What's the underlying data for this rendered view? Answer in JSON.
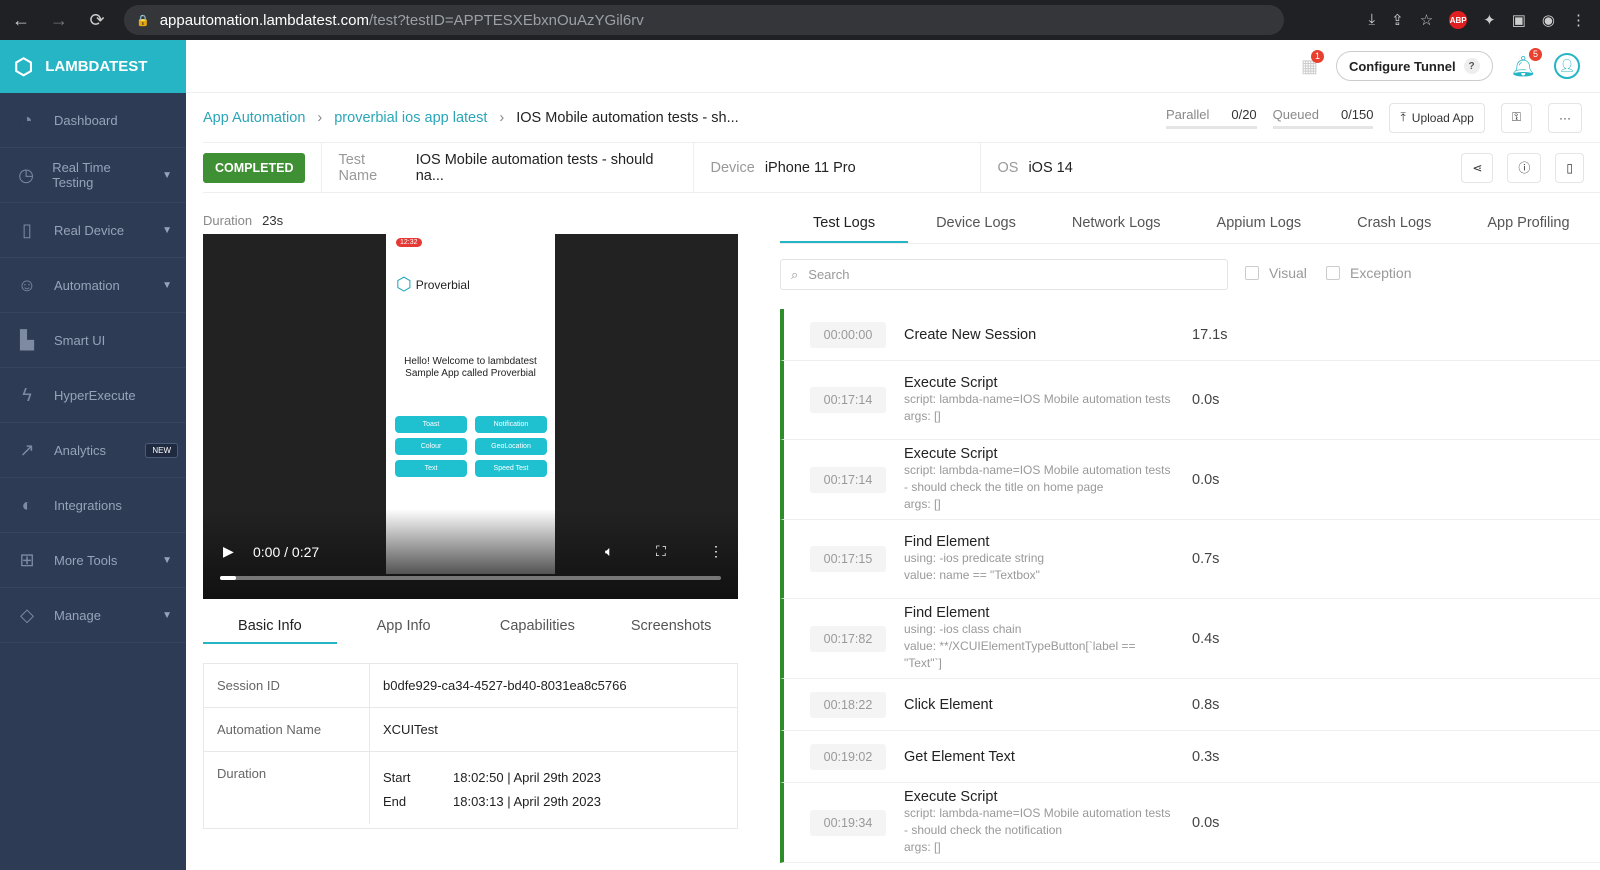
{
  "browser": {
    "url_host": "appautomation.lambdatest.com",
    "url_path": "/test?testID=APPTESXEbxnOuAzYGil6rv",
    "abp": "ABP"
  },
  "sidebar": {
    "brand": "LAMBDATEST",
    "items": [
      {
        "label": "Dashboard",
        "icon": "gauge"
      },
      {
        "label": "Real Time Testing",
        "icon": "clock",
        "chevron": true
      },
      {
        "label": "Real Device",
        "icon": "device",
        "chevron": true
      },
      {
        "label": "Automation",
        "icon": "robot",
        "chevron": true
      },
      {
        "label": "Smart UI",
        "icon": "smart"
      },
      {
        "label": "HyperExecute",
        "icon": "bolt"
      },
      {
        "label": "Analytics",
        "icon": "chart",
        "badge": "NEW"
      },
      {
        "label": "Integrations",
        "icon": "plug"
      },
      {
        "label": "More Tools",
        "icon": "plus",
        "chevron": true
      },
      {
        "label": "Manage",
        "icon": "shapes",
        "chevron": true
      }
    ]
  },
  "topbar": {
    "apps_badge": "1",
    "configure_tunnel": "Configure Tunnel",
    "help": "?",
    "notif_badge": "5"
  },
  "breadcrumb": {
    "items": [
      "App Automation",
      "proverbial ios app latest"
    ],
    "current": "IOS Mobile automation tests - sh..."
  },
  "stats": {
    "parallel_label": "Parallel",
    "parallel": "0/20",
    "queued_label": "Queued",
    "queued": "0/150",
    "upload": "Upload App"
  },
  "test": {
    "status": "COMPLETED",
    "name_label": "Test Name",
    "name": "IOS Mobile automation tests - should na...",
    "device_label": "Device",
    "device": "iPhone 11 Pro",
    "os_label": "OS",
    "os": "iOS 14",
    "duration_label": "Duration",
    "duration": "23s"
  },
  "video": {
    "time": "0:00 / 0:27",
    "progress": 0,
    "phone": {
      "clock": "12:32",
      "app_name": "Proverbial",
      "welcome": "Hello! Welcome to lambdatest Sample App called Proverbial",
      "buttons": [
        "Toast",
        "Notification",
        "Colour",
        "GeoLocation",
        "Text",
        "Speed Test"
      ]
    }
  },
  "info_tabs": [
    "Basic Info",
    "App Info",
    "Capabilities",
    "Screenshots"
  ],
  "basic_info": {
    "session_label": "Session ID",
    "session": "b0dfe929-ca34-4527-bd40-8031ea8c5766",
    "automation_label": "Automation Name",
    "automation": "XCUITest",
    "duration_label": "Duration",
    "start_label": "Start",
    "start": "18:02:50 | April 29th 2023",
    "end_label": "End",
    "end": "18:03:13 | April 29th 2023"
  },
  "log_tabs": [
    "Test Logs",
    "Device Logs",
    "Network Logs",
    "Appium Logs",
    "Crash Logs",
    "App Profiling"
  ],
  "log_search_placeholder": "Search",
  "filters": [
    "Visual",
    "Exception"
  ],
  "logs": [
    {
      "time": "00:00:00",
      "title": "Create New Session",
      "details": [],
      "dur": "17.1s"
    },
    {
      "time": "00:17:14",
      "title": "Execute Script",
      "details": [
        "script: lambda-name=IOS Mobile automation tests",
        "args: []"
      ],
      "dur": "0.0s"
    },
    {
      "time": "00:17:14",
      "title": "Execute Script",
      "details": [
        "script: lambda-name=IOS Mobile automation tests - should check the title on home page",
        "args: []"
      ],
      "dur": "0.0s"
    },
    {
      "time": "00:17:15",
      "title": "Find Element",
      "details": [
        "using: -ios predicate string",
        "value: name == \"Textbox\""
      ],
      "dur": "0.7s"
    },
    {
      "time": "00:17:82",
      "title": "Find Element",
      "details": [
        "using: -ios class chain",
        "value: **/XCUIElementTypeButton[`label == \"Text\"`]"
      ],
      "dur": "0.4s"
    },
    {
      "time": "00:18:22",
      "title": "Click Element",
      "details": [],
      "dur": "0.8s"
    },
    {
      "time": "00:19:02",
      "title": "Get Element Text",
      "details": [],
      "dur": "0.3s"
    },
    {
      "time": "00:19:34",
      "title": "Execute Script",
      "details": [
        "script: lambda-name=IOS Mobile automation tests - should check the notification",
        "args: []"
      ],
      "dur": "0.0s"
    }
  ]
}
